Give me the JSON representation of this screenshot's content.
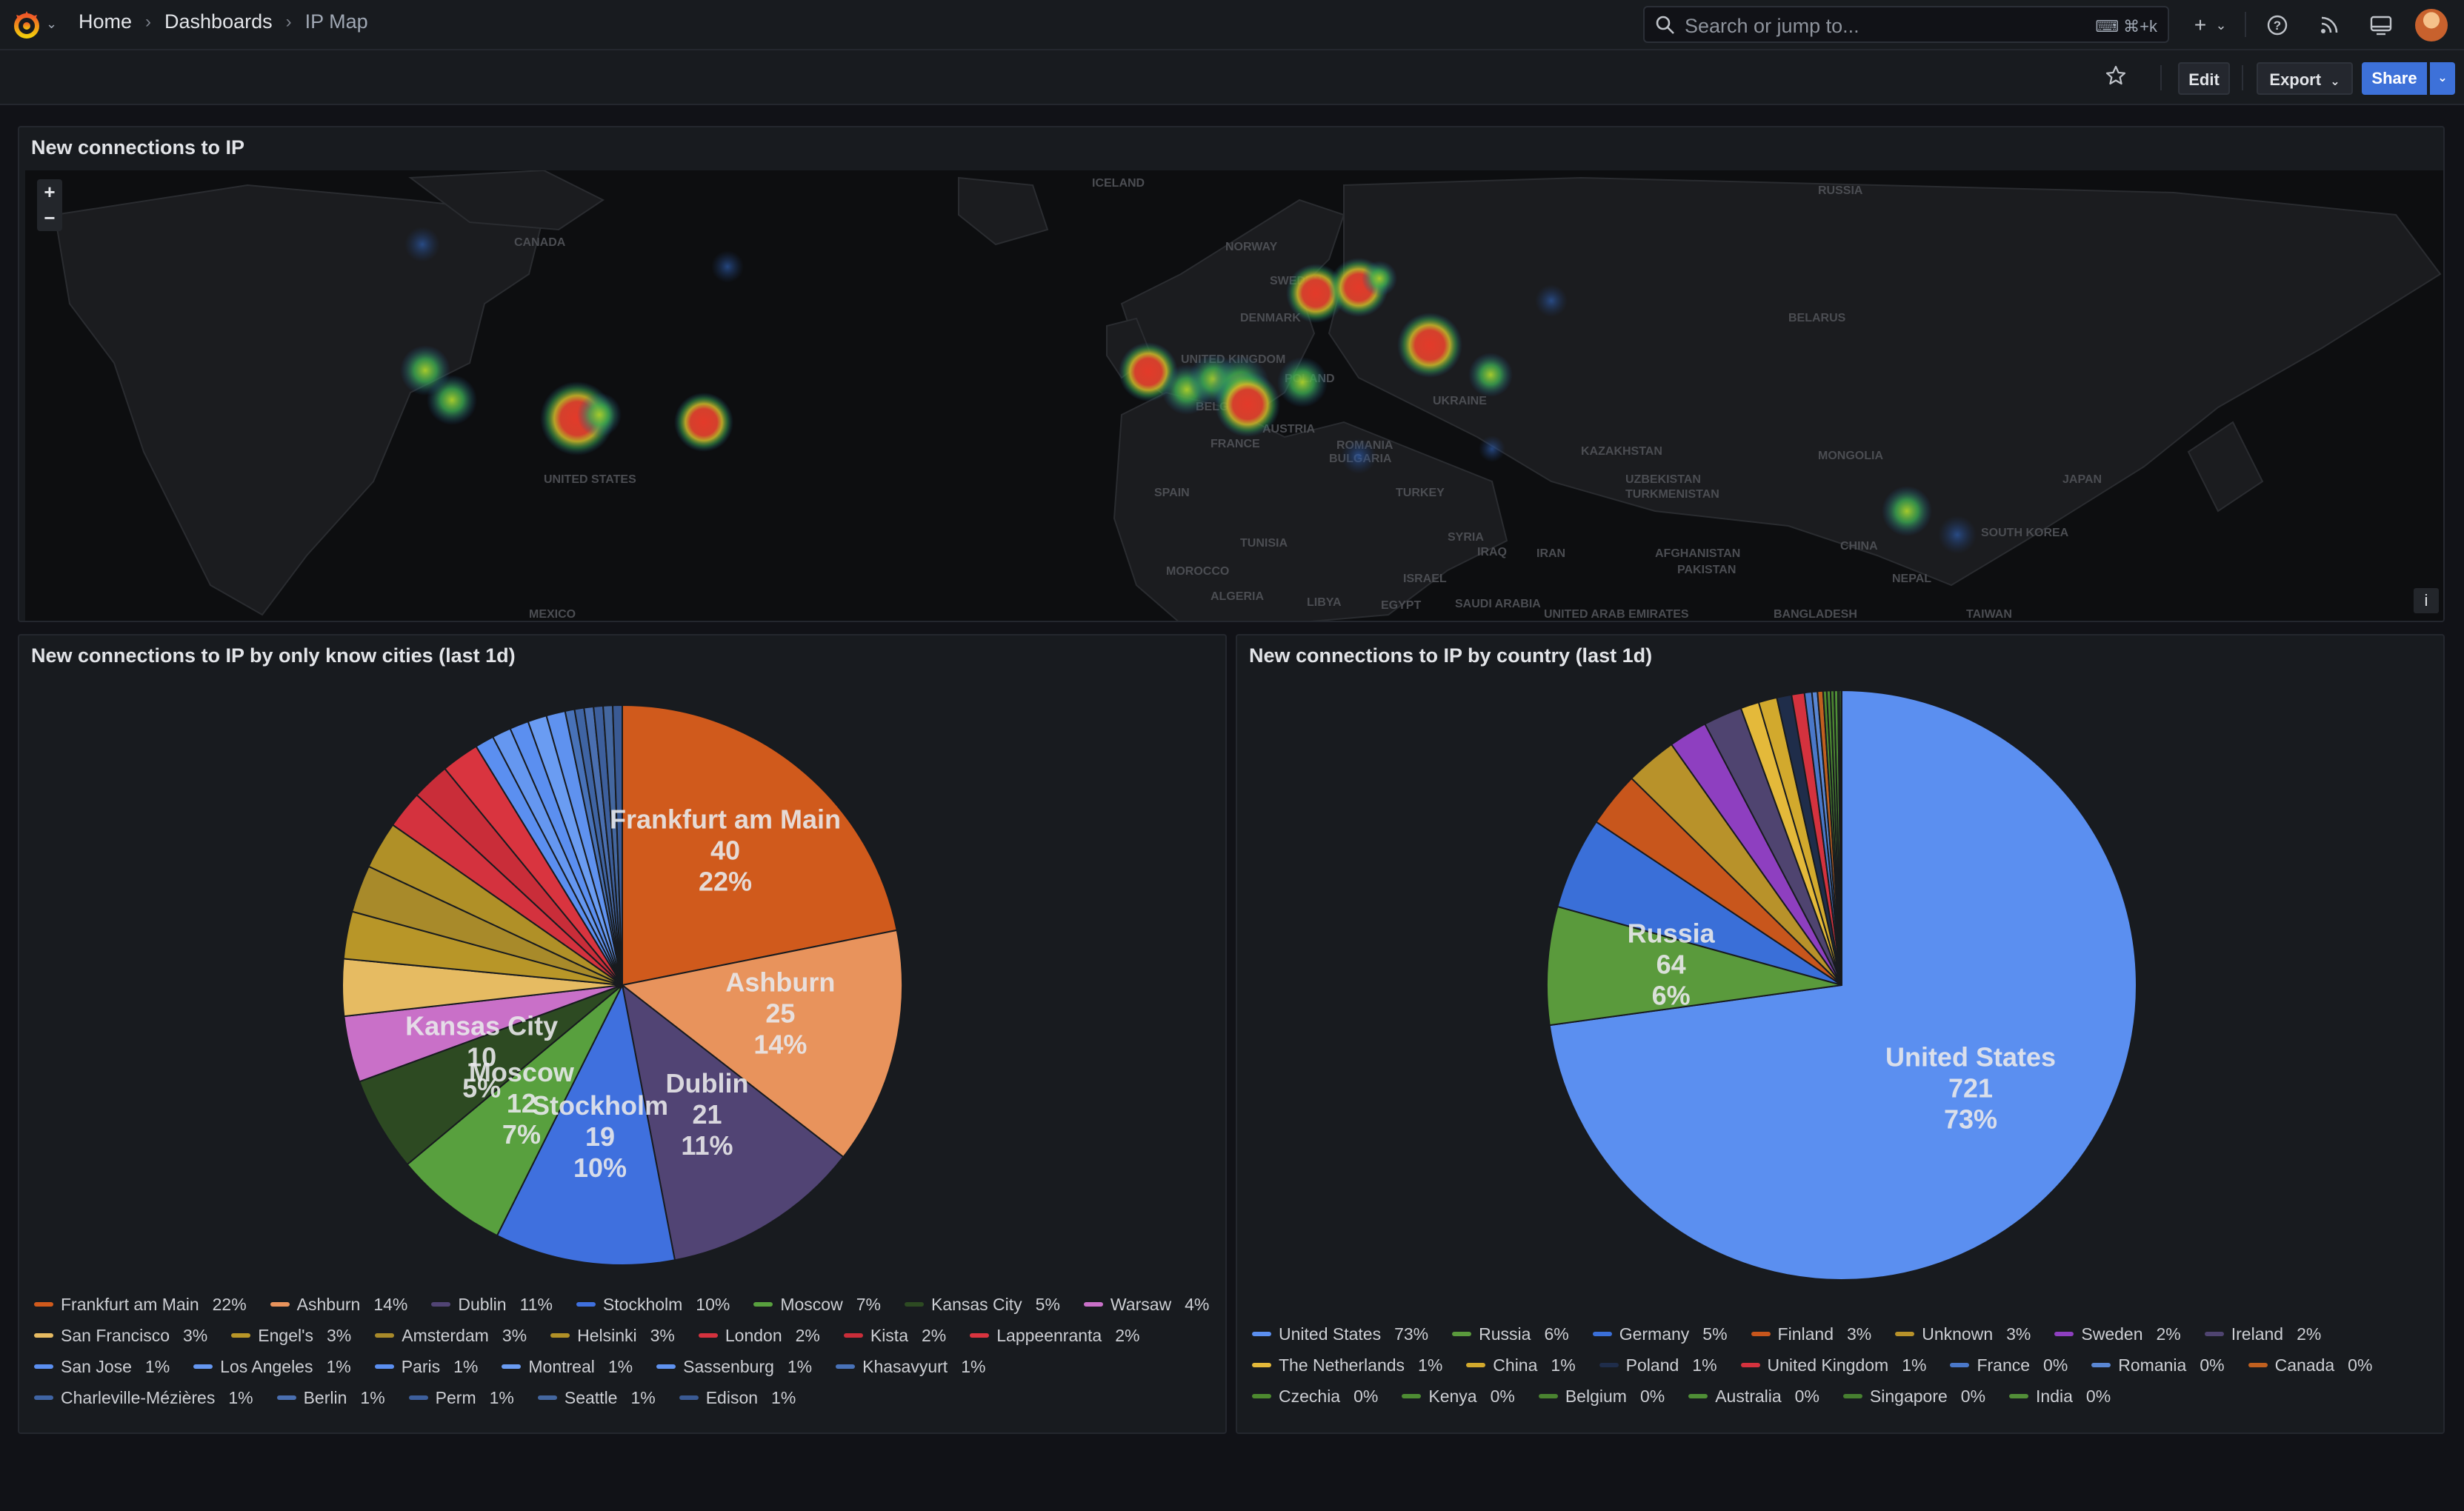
{
  "colors": {
    "bg": "#111217",
    "panel": "#181b1f",
    "accent": "#3d71d9"
  },
  "nav": {
    "breadcrumbs": [
      "Home",
      "Dashboards",
      "IP Map"
    ],
    "search_placeholder": "Search or jump to...",
    "search_shortcut": "⌘+k"
  },
  "toolbar": {
    "edit_label": "Edit",
    "export_label": "Export",
    "share_label": "Share"
  },
  "map_panel": {
    "title": "New connections to IP",
    "zoom_in": "+",
    "zoom_out": "−",
    "info": "i",
    "labels": [
      {
        "text": "ICELAND"
      },
      {
        "text": "RUSSIA"
      },
      {
        "text": "CANADA"
      },
      {
        "text": "NORWAY"
      },
      {
        "text": "SWEDEN"
      },
      {
        "text": "DENMARK"
      },
      {
        "text": "BELARUS"
      },
      {
        "text": "UNITED KINGDOM"
      },
      {
        "text": "POLAND"
      },
      {
        "text": "UKRAINE"
      },
      {
        "text": "BELGIUM"
      },
      {
        "text": "AUSTRIA"
      },
      {
        "text": "FRANCE"
      },
      {
        "text": "ROMANIA"
      },
      {
        "text": "BULGARIA"
      },
      {
        "text": "KAZAKHSTAN"
      },
      {
        "text": "MONGOLIA"
      },
      {
        "text": "UNITED STATES"
      },
      {
        "text": "SPAIN"
      },
      {
        "text": "TURKEY"
      },
      {
        "text": "UZBEKISTAN"
      },
      {
        "text": "TURKMENISTAN"
      },
      {
        "text": "JAPAN"
      },
      {
        "text": "SOUTH KOREA"
      },
      {
        "text": "CHINA"
      },
      {
        "text": "TUNISIA"
      },
      {
        "text": "SYRIA"
      },
      {
        "text": "IRAQ"
      },
      {
        "text": "IRAN"
      },
      {
        "text": "AFGHANISTAN"
      },
      {
        "text": "PAKISTAN"
      },
      {
        "text": "MOROCCO"
      },
      {
        "text": "ISRAEL"
      },
      {
        "text": "NEPAL"
      },
      {
        "text": "MEXICO"
      },
      {
        "text": "ALGERIA"
      },
      {
        "text": "LIBYA"
      },
      {
        "text": "EGYPT"
      },
      {
        "text": "SAUDI ARABIA"
      },
      {
        "text": "UNITED ARAB EMIRATES"
      },
      {
        "text": "BANGLADESH"
      },
      {
        "text": "TAIWAN"
      }
    ]
  },
  "cities_panel": {
    "title": "New connections to IP by only know cities (last 1d)",
    "chart_data": {
      "type": "pie",
      "title": "New connections to IP by only know cities (last 1d)",
      "slices": [
        {
          "name": "Frankfurt am Main",
          "value": 40,
          "pct": "22%",
          "color": "#d05a1c",
          "label": true
        },
        {
          "name": "Ashburn",
          "value": 25,
          "pct": "14%",
          "color": "#e8935c",
          "label": true
        },
        {
          "name": "Dublin",
          "value": 21,
          "pct": "11%",
          "color": "#514474",
          "label": true
        },
        {
          "name": "Stockholm",
          "value": 19,
          "pct": "10%",
          "color": "#3f70de",
          "label": true
        },
        {
          "name": "Moscow",
          "value": 12,
          "pct": "7%",
          "color": "#58a03e",
          "label": true
        },
        {
          "name": "Kansas City",
          "value": 10,
          "pct": "5%",
          "color": "#2d4a22",
          "label": true
        },
        {
          "name": "Warsaw",
          "value": 7,
          "pct": "4%",
          "color": "#c970c8",
          "label": false
        },
        {
          "name": "San Francisco",
          "value": 6,
          "pct": "3%",
          "color": "#e6bb62",
          "label": false
        },
        {
          "name": "Engel's",
          "value": 5,
          "pct": "3%",
          "color": "#b89628",
          "label": false
        },
        {
          "name": "Amsterdam",
          "value": 5,
          "pct": "3%",
          "color": "#a88a2a",
          "label": false
        },
        {
          "name": "Helsinki",
          "value": 5,
          "pct": "3%",
          "color": "#b09027",
          "label": false
        },
        {
          "name": "London",
          "value": 4,
          "pct": "2%",
          "color": "#d4323e",
          "label": false
        },
        {
          "name": "Kista",
          "value": 4,
          "pct": "2%",
          "color": "#c92d39",
          "label": false
        },
        {
          "name": "Lappeenranta",
          "value": 4,
          "pct": "2%",
          "color": "#d9343f",
          "label": false
        },
        {
          "name": "San Jose",
          "value": 2,
          "pct": "1%",
          "color": "#5b8ff0",
          "label": false
        },
        {
          "name": "Los Angeles",
          "value": 2,
          "pct": "1%",
          "color": "#6597f0",
          "label": false
        },
        {
          "name": "Paris",
          "value": 2,
          "pct": "1%",
          "color": "#5b8ff0",
          "label": false
        },
        {
          "name": "Montreal",
          "value": 2,
          "pct": "1%",
          "color": "#6a9cf2",
          "label": false
        },
        {
          "name": "Sassenburg",
          "value": 2,
          "pct": "1%",
          "color": "#5f92ef",
          "label": false
        },
        {
          "name": "Khasavyurt",
          "value": 1,
          "pct": "1%",
          "color": "#4872b8",
          "label": false
        },
        {
          "name": "Charleville-Mézières",
          "value": 1,
          "pct": "1%",
          "color": "#3f64a3",
          "label": false
        },
        {
          "name": "Berlin",
          "value": 1,
          "pct": "1%",
          "color": "#4a6fb0",
          "label": false
        },
        {
          "name": "Perm",
          "value": 1,
          "pct": "1%",
          "color": "#3d5f9c",
          "label": false
        },
        {
          "name": "Seattle",
          "value": 1,
          "pct": "1%",
          "color": "#44679f",
          "label": false
        },
        {
          "name": "Edison",
          "value": 1,
          "pct": "1%",
          "color": "#3a5a93",
          "label": false
        }
      ]
    }
  },
  "country_panel": {
    "title": "New connections to IP by country (last 1d)",
    "chart_data": {
      "type": "pie",
      "title": "New connections to IP by country (last 1d)",
      "slices": [
        {
          "name": "United States",
          "value": 721,
          "pct": "73%",
          "color": "#5b8ff0",
          "label": true
        },
        {
          "name": "Russia",
          "value": 64,
          "pct": "6%",
          "color": "#5a9a3c",
          "label": true
        },
        {
          "name": "Germany",
          "value": 50,
          "pct": "5%",
          "color": "#3a6fd8",
          "label": false
        },
        {
          "name": "Finland",
          "value": 30,
          "pct": "3%",
          "color": "#c8561c",
          "label": false
        },
        {
          "name": "Unknown",
          "value": 28,
          "pct": "3%",
          "color": "#b8922a",
          "label": false
        },
        {
          "name": "Sweden",
          "value": 21,
          "pct": "2%",
          "color": "#8e3fc0",
          "label": false
        },
        {
          "name": "Ireland",
          "value": 21,
          "pct": "2%",
          "color": "#4f4470",
          "label": false
        },
        {
          "name": "The Netherlands",
          "value": 10,
          "pct": "1%",
          "color": "#e4b93a",
          "label": false
        },
        {
          "name": "China",
          "value": 10,
          "pct": "1%",
          "color": "#d2a92d",
          "label": false
        },
        {
          "name": "Poland",
          "value": 8,
          "pct": "1%",
          "color": "#1f2d4a",
          "label": false
        },
        {
          "name": "United Kingdom",
          "value": 7,
          "pct": "1%",
          "color": "#d4323e",
          "label": false
        },
        {
          "name": "France",
          "value": 4,
          "pct": "0%",
          "color": "#4a78c9",
          "label": false
        },
        {
          "name": "Romania",
          "value": 3,
          "pct": "0%",
          "color": "#5a87d3",
          "label": false
        },
        {
          "name": "Canada",
          "value": 3,
          "pct": "0%",
          "color": "#c0601f",
          "label": false
        },
        {
          "name": "Czechia",
          "value": 2,
          "pct": "0%",
          "color": "#4d8a2f",
          "label": false
        },
        {
          "name": "Kenya",
          "value": 2,
          "pct": "0%",
          "color": "#4e8d33",
          "label": false
        },
        {
          "name": "Belgium",
          "value": 2,
          "pct": "0%",
          "color": "#4a8430",
          "label": false
        },
        {
          "name": "Australia",
          "value": 2,
          "pct": "0%",
          "color": "#4f8f36",
          "label": false
        },
        {
          "name": "Singapore",
          "value": 1,
          "pct": "0%",
          "color": "#478030",
          "label": false
        },
        {
          "name": "India",
          "value": 1,
          "pct": "0%",
          "color": "#528f38",
          "label": false
        }
      ]
    }
  }
}
